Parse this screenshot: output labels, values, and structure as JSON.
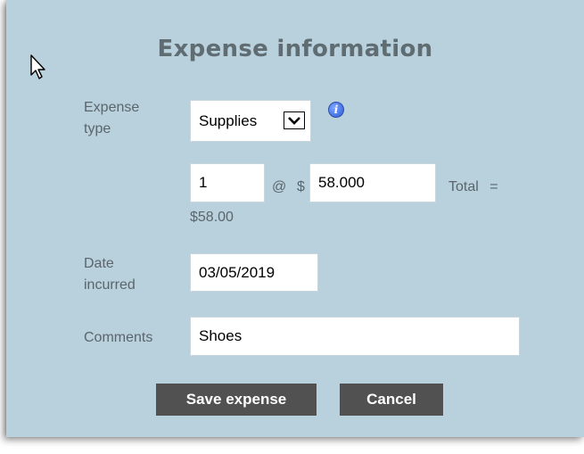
{
  "form": {
    "title": "Expense information",
    "expense_type_label": "Expense type",
    "expense_type_value": "Supplies",
    "quantity_value": "1",
    "at_symbol": "@",
    "currency_symbol": "$",
    "unit_price_value": "58.000",
    "total_label": "Total =",
    "total_value": "$58.00",
    "date_label": "Date incurred",
    "date_value": "03/05/2019",
    "comments_label": "Comments",
    "comments_value": "Shoes"
  },
  "buttons": {
    "save_label": "Save expense",
    "cancel_label": "Cancel"
  },
  "colors": {
    "panel_bg": "#b9d0dd",
    "title": "#5f6c72",
    "label": "#5a666c",
    "button_bg": "#515151"
  }
}
